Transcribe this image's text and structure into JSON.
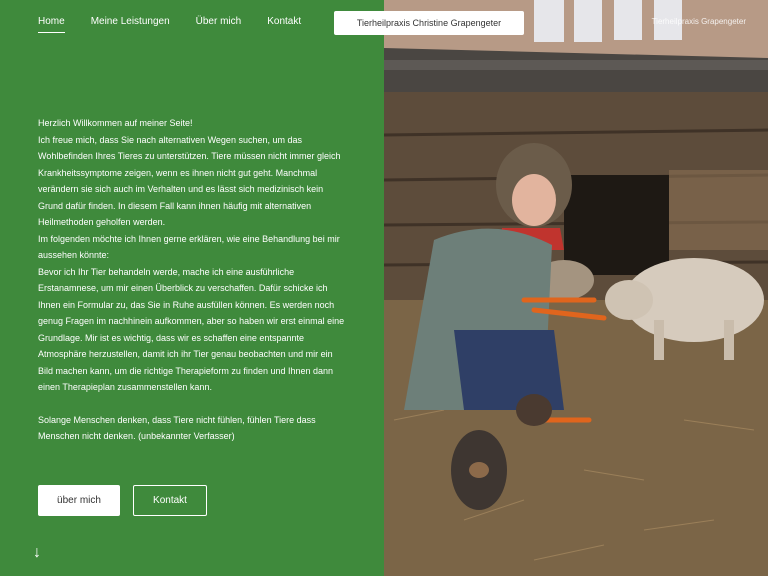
{
  "nav": {
    "items": [
      {
        "label": "Home",
        "active": true
      },
      {
        "label": "Meine Leistungen",
        "active": false
      },
      {
        "label": "Über mich",
        "active": false
      },
      {
        "label": "Kontakt",
        "active": false
      }
    ]
  },
  "brand": {
    "label": "Tierheilpraxis Christine Grapengeter"
  },
  "watermark": {
    "text": "Tierheilpraxis Grapengeter"
  },
  "content": {
    "greeting": "Herzlich Willkommen auf meiner Seite!",
    "paragraph1": "Ich freue mich, dass Sie nach alternativen Wegen suchen, um  das Wohlbefinden Ihres Tieres zu unterstützen. Tiere müssen nicht immer gleich Krankheitssymptome zeigen, wenn es ihnen nicht gut geht. Manchmal verändern sie sich auch im Verhalten und es lässt sich medizinisch kein Grund dafür finden. In diesem Fall kann ihnen häufig mit alternativen Heilmethoden geholfen werden.",
    "paragraph2": "Im folgenden möchte ich Ihnen gerne erklären, wie eine Behandlung bei mir aussehen könnte:",
    "paragraph3": "Bevor ich Ihr Tier behandeln werde, mache ich eine ausführliche Erstanamnese, um mir einen Überblick zu verschaffen. Dafür schicke ich Ihnen ein Formular zu, das Sie in Ruhe ausfüllen können. Es werden noch genug Fragen im nachhinein aufkommen, aber so haben wir erst einmal eine Grundlage. Mir ist es wichtig, dass wir es schaffen eine entspannte Atmosphäre herzustellen, damit ich ihr Tier genau beobachten und mir ein Bild machen kann, um die richtige Therapieform zu finden und Ihnen dann einen Therapieplan zusammenstellen kann.",
    "quote": "Solange Menschen denken, dass Tiere nicht fühlen, fühlen Tiere dass Menschen nicht denken. (unbekannter Verfasser)"
  },
  "buttons": {
    "primary": "über mich",
    "secondary": "Kontakt"
  },
  "scroll_arrow": "↓",
  "colors": {
    "accent_green": "#3f8a3c",
    "white": "#ffffff"
  }
}
